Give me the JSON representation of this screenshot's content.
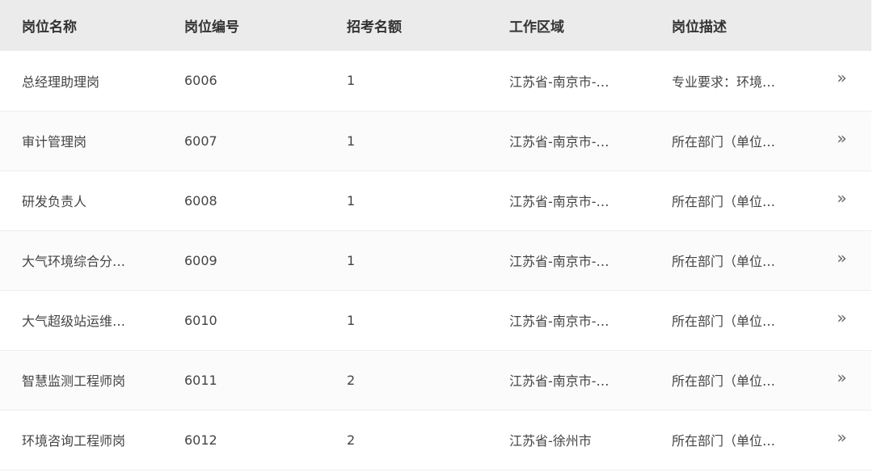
{
  "table": {
    "headers": {
      "name": "岗位名称",
      "code": "岗位编号",
      "quota": "招考名额",
      "area": "工作区域",
      "desc": "岗位描述"
    },
    "rows": [
      {
        "name": "总经理助理岗",
        "code": "6006",
        "quota": "1",
        "area": "江苏省-南京市-…",
        "desc": "专业要求：环境…"
      },
      {
        "name": "审计管理岗",
        "code": "6007",
        "quota": "1",
        "area": "江苏省-南京市-…",
        "desc": "所在部门（单位…"
      },
      {
        "name": "研发负责人",
        "code": "6008",
        "quota": "1",
        "area": "江苏省-南京市-…",
        "desc": "所在部门（单位…"
      },
      {
        "name": "大气环境综合分…",
        "code": "6009",
        "quota": "1",
        "area": "江苏省-南京市-…",
        "desc": "所在部门（单位…"
      },
      {
        "name": "大气超级站运维…",
        "code": "6010",
        "quota": "1",
        "area": "江苏省-南京市-…",
        "desc": "所在部门（单位…"
      },
      {
        "name": "智慧监测工程师岗",
        "code": "6011",
        "quota": "2",
        "area": "江苏省-南京市-…",
        "desc": "所在部门（单位…"
      },
      {
        "name": "环境咨询工程师岗",
        "code": "6012",
        "quota": "2",
        "area": "江苏省-徐州市",
        "desc": "所在部门（单位…"
      }
    ],
    "action_glyph": "»",
    "action_icon": "double-chevron-right-icon"
  }
}
